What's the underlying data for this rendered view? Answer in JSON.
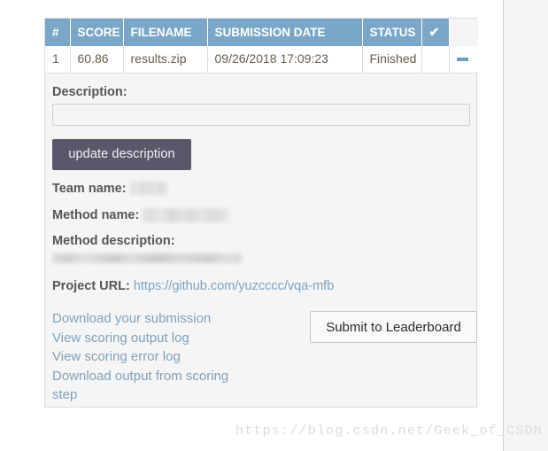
{
  "table": {
    "headers": [
      "#",
      "SCORE",
      "FILENAME",
      "SUBMISSION DATE",
      "STATUS"
    ],
    "check_header_icon": "check-icon",
    "rows": [
      {
        "num": "1",
        "score": "60.86",
        "filename": "results.zip",
        "submission_date": "09/26/2018 17:09:23",
        "status": "Finished",
        "check": "",
        "extra_icon": "minus-icon"
      }
    ]
  },
  "description": {
    "label": "Description:",
    "value": "",
    "placeholder": "",
    "update_button_label": "update description"
  },
  "meta": {
    "team_name_label": "Team name:",
    "team_name_value": "",
    "method_name_label": "Method name:",
    "method_name_value": "",
    "method_description_label": "Method description:",
    "method_description_value": ""
  },
  "project_url": {
    "label": "Project URL:",
    "url_text": "https://github.com/yuzcccc/vqa-mfb"
  },
  "actions": {
    "links": [
      "Download your submission",
      "View scoring output log",
      "View scoring error log",
      "Download output from scoring step"
    ],
    "submit_button_label": "Submit to Leaderboard"
  },
  "watermark": {
    "text": "https://blog.csdn.net/Geek_of_CSDN"
  },
  "colors": {
    "table_header_bg": "#7aa7c7",
    "update_button_bg": "#5b5669",
    "link_blue": "#7fa2bd",
    "panel_bg": "#f5f5f5",
    "minus_icon": "#6e9dbd"
  }
}
